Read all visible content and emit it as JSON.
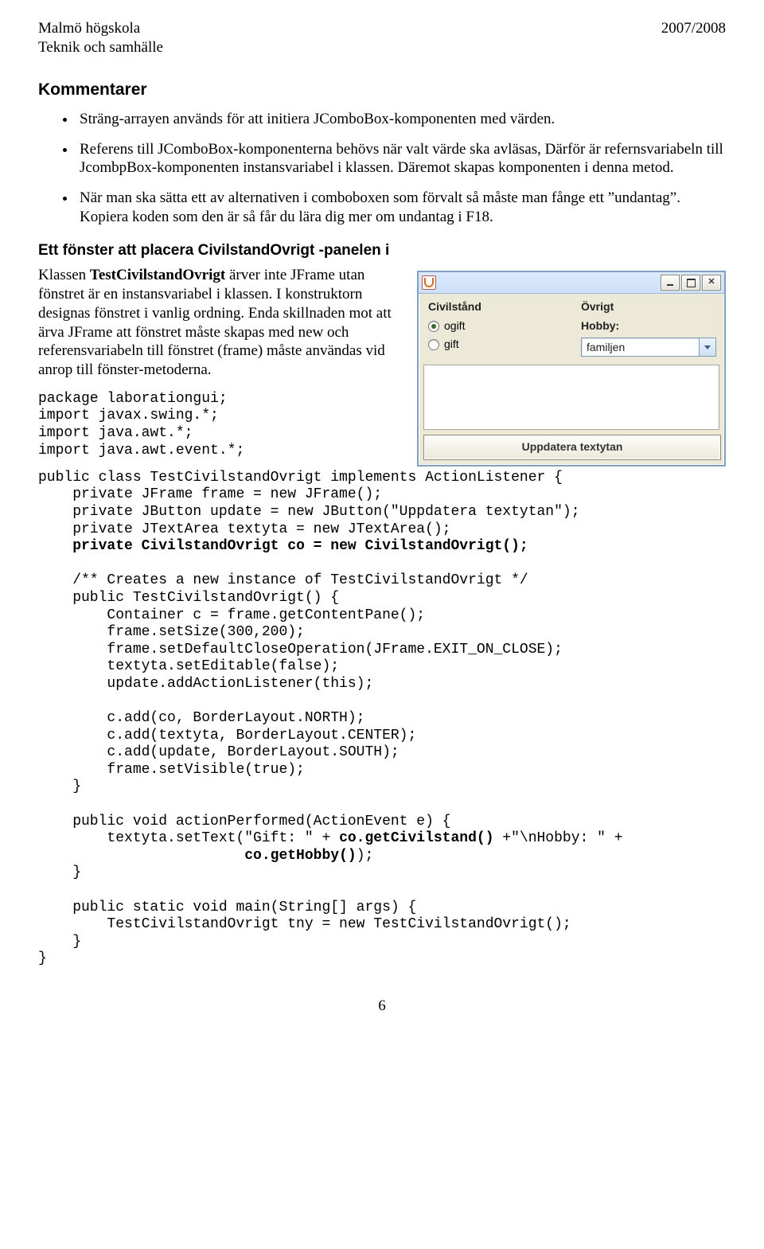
{
  "header": {
    "left_line1": "Malmö högskola",
    "left_line2": "Teknik och samhälle",
    "right": "2007/2008"
  },
  "section_heading": "Kommentarer",
  "bullets": [
    "Sträng-arrayen används för att initiera JComboBox-komponenten med värden.",
    "Referens till JComboBox-komponenterna behövs när valt värde ska avläsas, Därför är refernsvariabeln till JcombpBox-komponenten instansvariabel i klassen. Däremot skapas komponenten i denna metod.",
    "När man ska sätta ett av alternativen i comboboxen som förvalt så måste man fånge ett ”undantag”. Kopiera koden som den är så får du lära dig mer om undantag i F18."
  ],
  "subheading": "Ett fönster att placera CivilstandOvrigt -panelen i",
  "paragraph_parts": {
    "p1": "Klassen ",
    "p2_bold": "TestCivilstandOvrigt",
    "p3": " ärver inte JFrame utan fönstret är en instansvariabel i klassen. I konstruktorn designas fönstret i vanlig ordning. Enda skillnaden mot att ärva JFrame att fönstret måste skapas med new och referensvariabeln till fönstret (frame) måste användas vid anrop till fönster-metoderna."
  },
  "java_window": {
    "left_title": "Civilstånd",
    "right_title": "Övrigt",
    "radio1": "ogift",
    "radio2": "gift",
    "hobby_label": "Hobby:",
    "combo_value": "familjen",
    "button_label": "Uppdatera textytan"
  },
  "code_block": "package laborationgui;\nimport javax.swing.*;\nimport java.awt.*;\nimport java.awt.event.*;\n\npublic class TestCivilstandOvrigt implements ActionListener {\n    private JFrame frame = new JFrame();\n    private JButton update = new JButton(\"Uppdatera textytan\");\n    private JTextArea textyta = new JTextArea();\n    private CivilstandOvrigt co = new CivilstandOvrigt();\n\n    /** Creates a new instance of TestCivilstandOvrigt */\n    public TestCivilstandOvrigt() {\n        Container c = frame.getContentPane();\n        frame.setSize(300,200);\n        frame.setDefaultCloseOperation(JFrame.EXIT_ON_CLOSE);\n        textyta.setEditable(false);\n        update.addActionListener(this);\n\n        c.add(co, BorderLayout.NORTH);\n        c.add(textyta, BorderLayout.CENTER);\n        c.add(update, BorderLayout.SOUTH);\n        frame.setVisible(true);\n    }\n\n    public void actionPerformed(ActionEvent e) {\n        textyta.setText(\"Gift: \" + co.getCivilstand() +\"\\nHobby: \" +\n                        co.getHobby());\n    }\n\n    public static void main(String[] args) {\n        TestCivilstandOvrigt tny = new TestCivilstandOvrigt();\n    }\n}",
  "page_number": "6"
}
